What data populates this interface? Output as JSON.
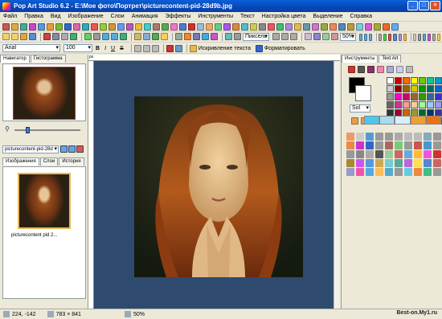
{
  "window": {
    "title": "Pop Art Studio 6.2 - E:\\Мое фото\\Портрет\\picturecontent-pid-28d9b.jpg"
  },
  "menu": [
    "Файл",
    "Правка",
    "Вид",
    "Изображение",
    "Слои",
    "Анимация",
    "Эффекты",
    "Инструменты",
    "Текст",
    "Настройка цвета",
    "Выделение",
    "Справка"
  ],
  "toolbar2": {
    "unit": "Пиксель",
    "zoom": "50%"
  },
  "toolbar3": {
    "font": "Arial",
    "size": "100",
    "bold": "B",
    "italic": "I",
    "underline": "U",
    "strike": "S",
    "distortion": "Искривление текста",
    "format": "Форматировать"
  },
  "left": {
    "tabs": [
      "Навигатор",
      "Гистограмма"
    ],
    "file_select": "picturecontent-pid-28d",
    "image_tabs": [
      "Изображения",
      "Слои",
      "История"
    ],
    "thumb_label": "picturecontent pid 2..."
  },
  "ruler": {
    "unit": "px"
  },
  "right": {
    "tabs": [
      "Инструменты",
      "Text Art"
    ],
    "mode_select": "Sol"
  },
  "status": {
    "coords": "224, -142",
    "size": "783 × 841",
    "zoom": "50%",
    "watermark": "Best-on.My1.ru"
  },
  "colors": {
    "titlebar": "#0a5fd8",
    "canvas": "#2f4a6f",
    "accent": "#e8b855"
  }
}
